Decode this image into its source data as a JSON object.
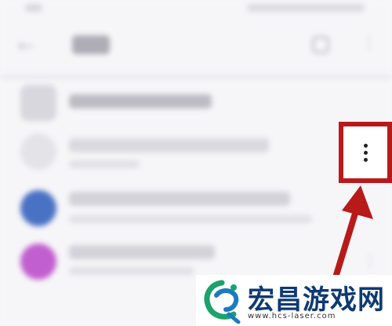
{
  "watermark": {
    "brand": "宏昌游戏网",
    "url": "www.hcs-laser.com"
  },
  "icons": {
    "back": "back-arrow-icon",
    "more": "more-vertical-icon",
    "callout_arrow": "red-arrow-icon"
  },
  "colors": {
    "highlight": "#b81a1a",
    "watermark_text": "#0e3a72",
    "avatar_blue": "#4a72c4",
    "avatar_purple": "#c25fd0"
  }
}
